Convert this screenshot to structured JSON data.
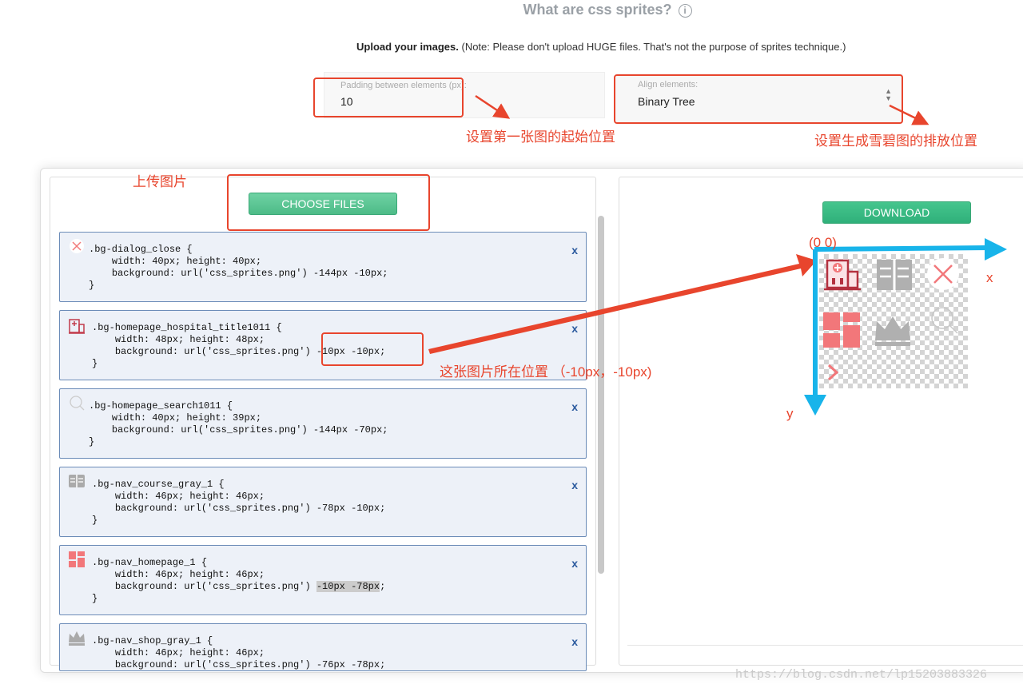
{
  "header": {
    "title": "What are css sprites?",
    "info_icon": "i",
    "upload_bold": "Upload your images.",
    "upload_note": " (Note: Please don't upload HUGE files. That's not the purpose of sprites technique.)"
  },
  "padding_field": {
    "label": "Padding between elements (px):",
    "value": "10"
  },
  "align_field": {
    "label": "Align elements:",
    "value": "Binary Tree"
  },
  "annotations": {
    "start_pos": "设置第一张图的起始位置",
    "arrange": "设置生成雪碧图的排放位置",
    "upload": "上传图片",
    "position": "这张图片所在位置 （-10px，-10px)",
    "origin": "(0    0)",
    "x_axis": "x",
    "y_axis": "y"
  },
  "buttons": {
    "choose": "CHOOSE FILES",
    "download": "DOWNLOAD",
    "remove": "x"
  },
  "cards": [
    {
      "selector": ".bg-dialog_close {",
      "size": "width: 40px; height: 40px;",
      "bg_prefix": "background: url('css_sprites.png') ",
      "pos": "-144px -10px",
      "icon": "close-icon",
      "close": "}"
    },
    {
      "selector": ".bg-homepage_hospital_title1011 {",
      "size": "width: 48px; height: 48px;",
      "bg_prefix": "background: url('css_sprites.png') ",
      "pos": "-10px -10px",
      "icon": "hospital-icon",
      "close": "}"
    },
    {
      "selector": ".bg-homepage_search1011 {",
      "size": "width: 40px; height: 39px;",
      "bg_prefix": "background: url('css_sprites.png') ",
      "pos": "-144px -70px",
      "icon": "search-icon",
      "close": "}"
    },
    {
      "selector": ".bg-nav_course_gray_1 {",
      "size": "width: 46px; height: 46px;",
      "bg_prefix": "background: url('css_sprites.png') ",
      "pos": "-78px -10px",
      "icon": "book-icon",
      "close": "}"
    },
    {
      "selector": ".bg-nav_homepage_1 {",
      "size": "width: 46px; height: 46px;",
      "bg_prefix": "background: url('css_sprites.png') ",
      "pos": "-10px -78px",
      "icon": "grid-icon",
      "close": "}"
    },
    {
      "selector": ".bg-nav_shop_gray_1 {",
      "size": "width: 46px; height: 46px;",
      "bg_prefix": "background: url('css_sprites.png') ",
      "pos": "-76px -78px",
      "icon": "crown-icon",
      "close": "}"
    }
  ],
  "watermark": "https://blog.csdn.net/lp15203883326",
  "colors": {
    "annotation": "#e8452d",
    "axis": "#18b4ea",
    "button": "#4dbb87",
    "sprite_red": "#f2777a",
    "sprite_gray": "#b0b0b0"
  }
}
